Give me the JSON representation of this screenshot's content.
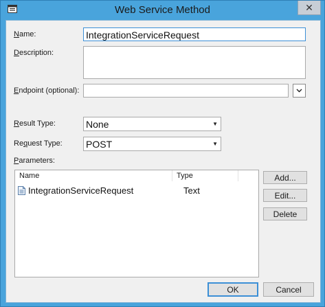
{
  "window": {
    "title": "Web Service Method",
    "close_glyph": "✕"
  },
  "form": {
    "name": {
      "label": "Name:",
      "underline": "N",
      "rest": "ame:",
      "value": "IntegrationServiceRequest"
    },
    "description": {
      "label": "Description:",
      "underline": "D",
      "rest": "escription:",
      "value": ""
    },
    "endpoint": {
      "label": "Endpoint (optional):",
      "underline": "E",
      "rest": "ndpoint (optional):",
      "value": ""
    },
    "result_type": {
      "label": "Result Type:",
      "underline": "R",
      "rest": "esult Type:",
      "value": "None"
    },
    "request_type": {
      "label": "Request Type:",
      "pre": "Re",
      "underline": "q",
      "rest": "uest Type:",
      "value": "POST"
    },
    "parameters": {
      "label": "Parameters:",
      "underline": "P",
      "rest": "arameters:"
    }
  },
  "parameters_table": {
    "columns": [
      "Name",
      "Type"
    ],
    "rows": [
      {
        "name": "IntegrationServiceRequest",
        "type": "Text",
        "icon": "document-icon"
      }
    ]
  },
  "buttons": {
    "add": "Add...",
    "edit": "Edit...",
    "delete": "Delete",
    "ok": "OK",
    "cancel": "Cancel"
  },
  "colors": {
    "title_bar": "#49a4dc",
    "focus_border": "#3b8fd6"
  }
}
